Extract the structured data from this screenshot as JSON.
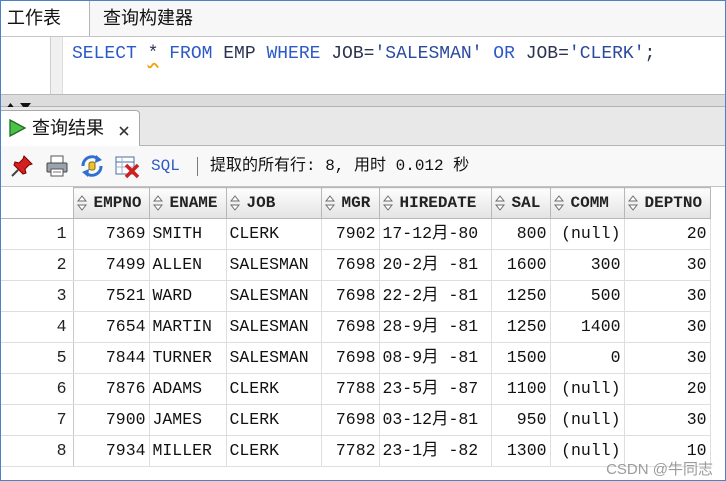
{
  "colors": {
    "keyword": "#2c5ac8",
    "sql_link": "#2c5ac8",
    "frame": "#4a83c4",
    "squiggle": "#f0a000"
  },
  "tabs": [
    {
      "label": "工作表",
      "active": true
    },
    {
      "label": "查询构建器",
      "active": false
    }
  ],
  "editor": {
    "tokens": [
      "SELECT",
      "*",
      "FROM",
      "EMP",
      "WHERE",
      "JOB",
      "=",
      "'SALESMAN'",
      "OR",
      "JOB",
      "=",
      "'CLERK'",
      ";"
    ]
  },
  "splitter": {
    "icons": [
      "collapse-up-icon",
      "expand-down-icon"
    ]
  },
  "results_tab": {
    "icon": "run-icon",
    "label": "查询结果",
    "close_icon": "close-icon"
  },
  "toolbar": {
    "icons": [
      "pin-icon",
      "print-icon",
      "refresh-icon",
      "delete-icon"
    ],
    "sql_label": "SQL",
    "status": "提取的所有行: 8, 用时 0.012 秒"
  },
  "table": {
    "sort_icon": "sort-icon",
    "columns": [
      "EMPNO",
      "ENAME",
      "JOB",
      "MGR",
      "HIREDATE",
      "SAL",
      "COMM",
      "DEPTNO"
    ],
    "rows": [
      {
        "n": "1",
        "cells": [
          "7369",
          "SMITH",
          "CLERK",
          "7902",
          "17-12月-80",
          "800",
          "(null)",
          "20"
        ]
      },
      {
        "n": "2",
        "cells": [
          "7499",
          "ALLEN",
          "SALESMAN",
          "7698",
          "20-2月 -81",
          "1600",
          "300",
          "30"
        ]
      },
      {
        "n": "3",
        "cells": [
          "7521",
          "WARD",
          "SALESMAN",
          "7698",
          "22-2月 -81",
          "1250",
          "500",
          "30"
        ]
      },
      {
        "n": "4",
        "cells": [
          "7654",
          "MARTIN",
          "SALESMAN",
          "7698",
          "28-9月 -81",
          "1250",
          "1400",
          "30"
        ]
      },
      {
        "n": "5",
        "cells": [
          "7844",
          "TURNER",
          "SALESMAN",
          "7698",
          "08-9月 -81",
          "1500",
          "0",
          "30"
        ]
      },
      {
        "n": "6",
        "cells": [
          "7876",
          "ADAMS",
          "CLERK",
          "7788",
          "23-5月 -87",
          "1100",
          "(null)",
          "20"
        ]
      },
      {
        "n": "7",
        "cells": [
          "7900",
          "JAMES",
          "CLERK",
          "7698",
          "03-12月-81",
          "950",
          "(null)",
          "30"
        ]
      },
      {
        "n": "8",
        "cells": [
          "7934",
          "MILLER",
          "CLERK",
          "7782",
          "23-1月 -82",
          "1300",
          "(null)",
          "10"
        ]
      }
    ]
  },
  "watermark": "CSDN @牛同志"
}
